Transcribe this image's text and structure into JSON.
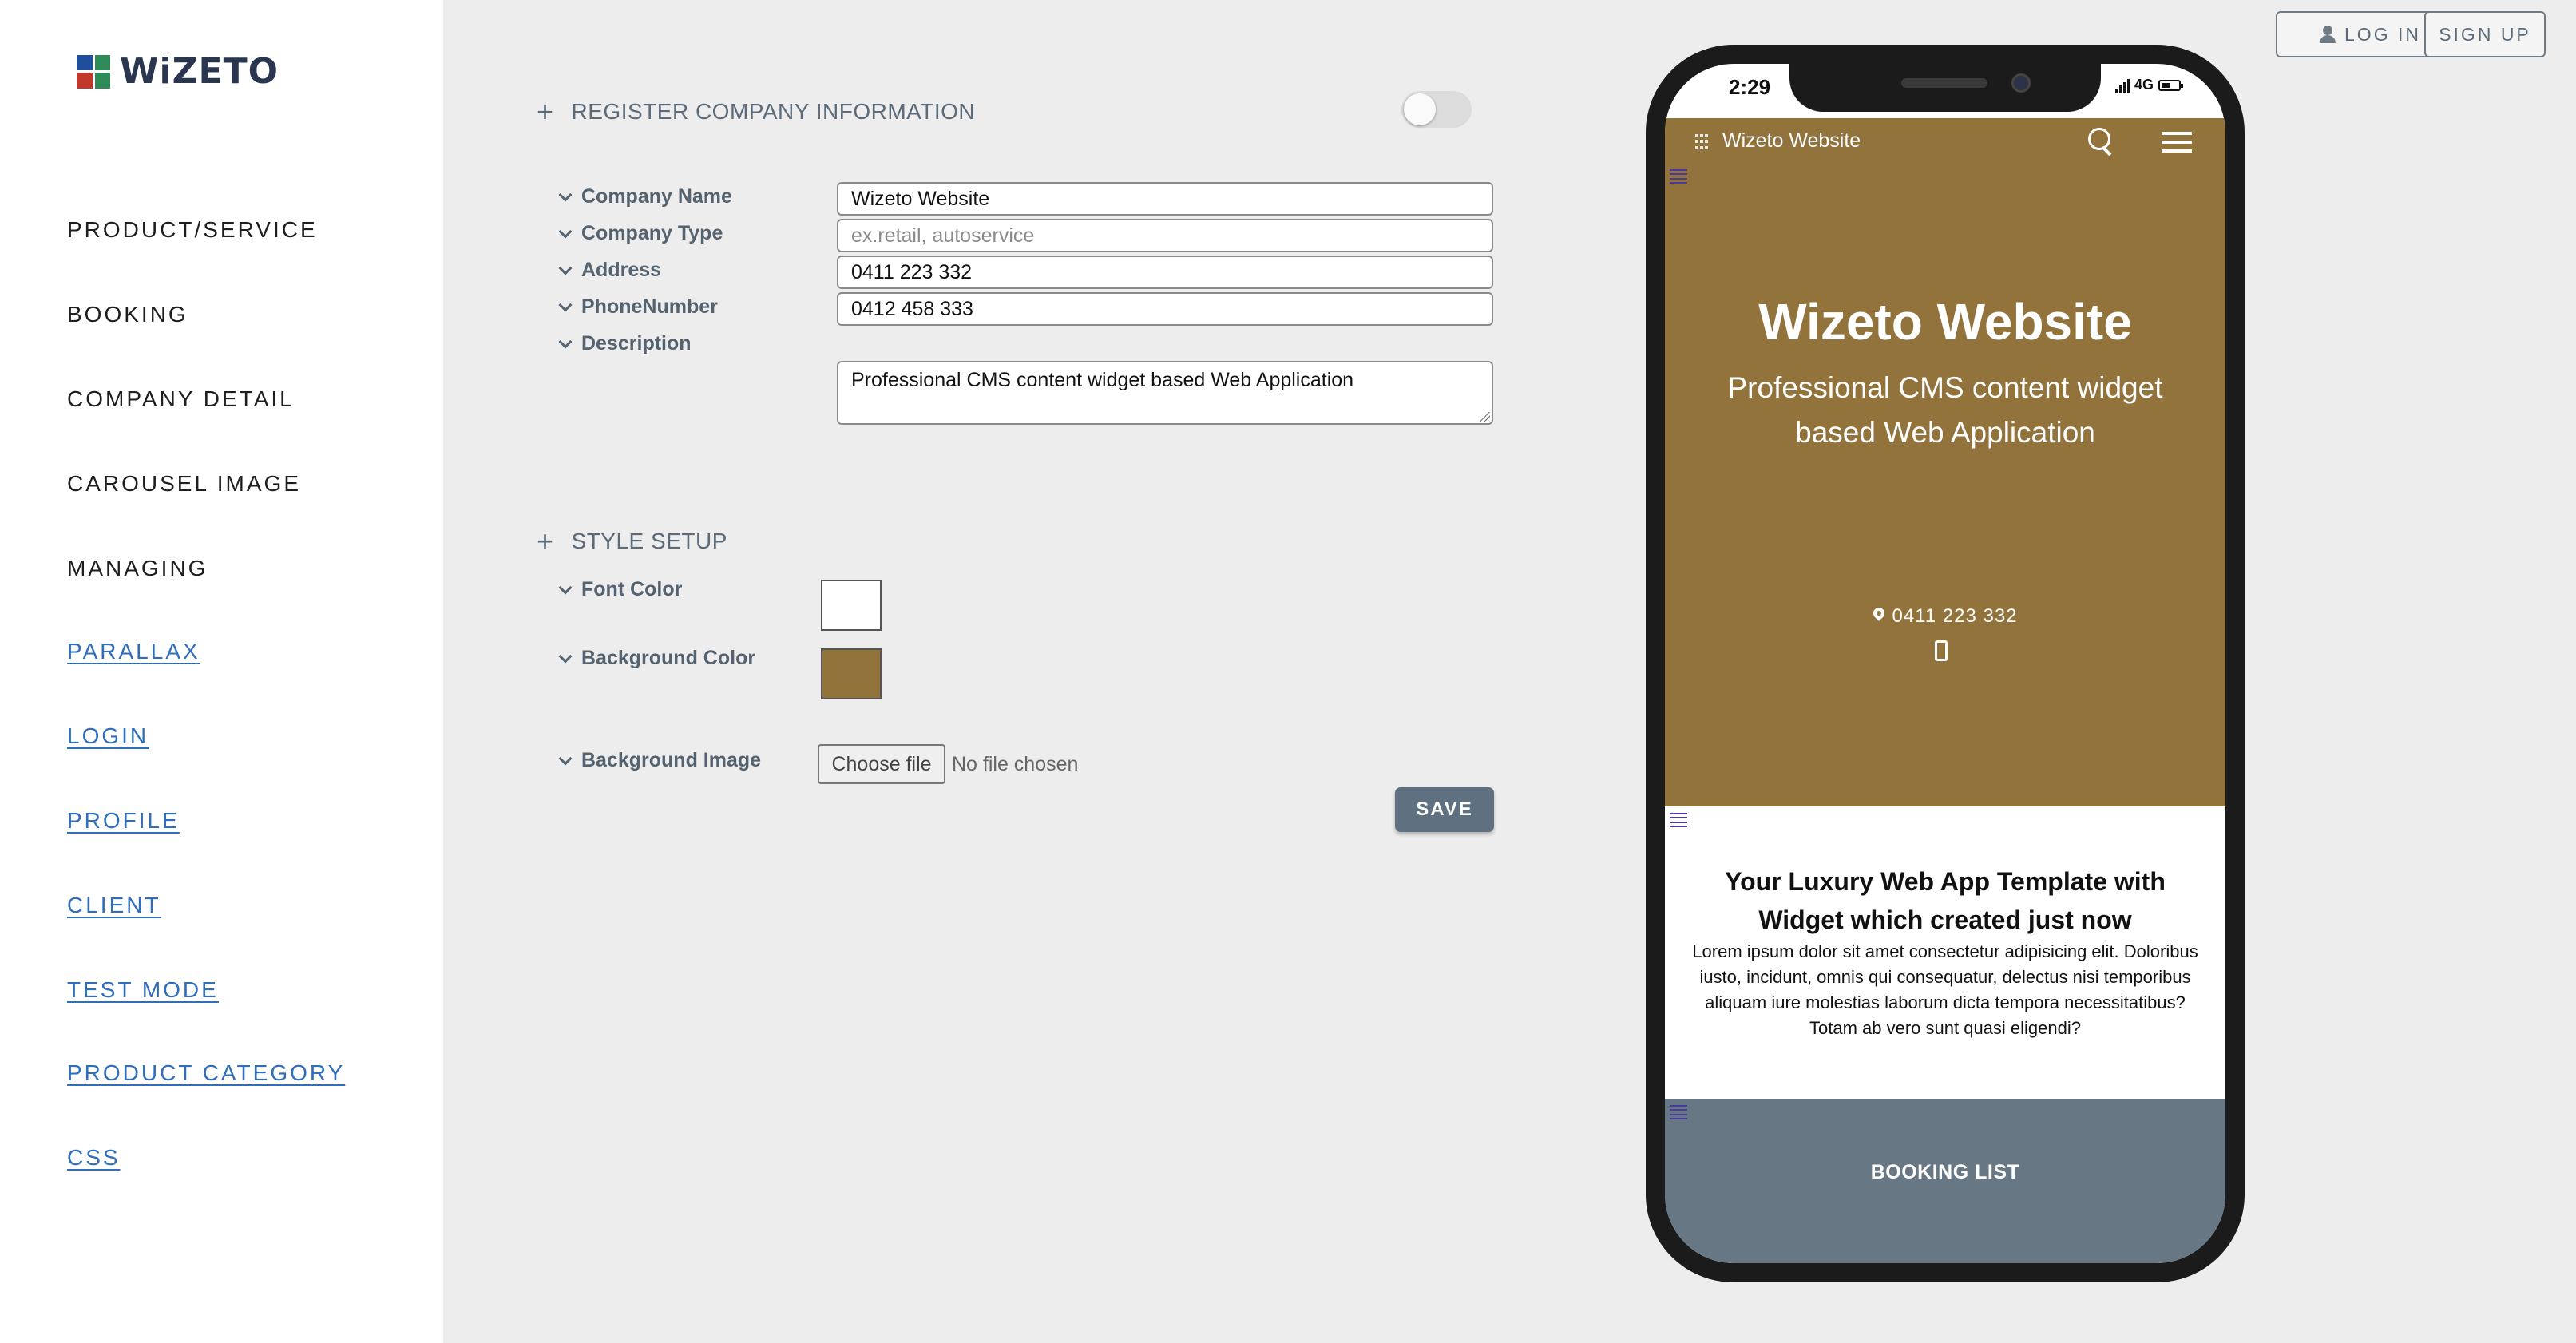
{
  "brand": {
    "name": "WiZETO",
    "colors": [
      "#1f4e9c",
      "#2e8b57",
      "#c0392b",
      "#2e8b57"
    ]
  },
  "sidebar": {
    "items": [
      {
        "label": "PRODUCT/SERVICE",
        "link": false
      },
      {
        "label": "BOOKING",
        "link": false
      },
      {
        "label": "COMPANY DETAIL",
        "link": false
      },
      {
        "label": "CAROUSEL IMAGE",
        "link": false
      },
      {
        "label": "MANAGING",
        "link": false
      },
      {
        "label": "PARALLAX",
        "link": true
      },
      {
        "label": "LOGIN",
        "link": true
      },
      {
        "label": "PROFILE",
        "link": true
      },
      {
        "label": "CLIENT",
        "link": true
      },
      {
        "label": "TEST MODE",
        "link": true
      },
      {
        "label": "PRODUCT CATEGORY",
        "link": true
      },
      {
        "label": "CSS",
        "link": true
      }
    ]
  },
  "header": {
    "login_label": "LOG IN",
    "signup_label": "SIGN UP"
  },
  "company_form": {
    "section_title": "REGISTER COMPANY INFORMATION",
    "toggle_on": false,
    "fields": {
      "company_name": {
        "label": "Company Name",
        "value": "Wizeto Website"
      },
      "company_type": {
        "label": "Company Type",
        "value": "",
        "placeholder": "ex.retail, autoservice"
      },
      "address": {
        "label": "Address",
        "value": "0411 223 332"
      },
      "phone": {
        "label": "PhoneNumber",
        "value": "0412 458 333"
      },
      "description": {
        "label": "Description",
        "value": "Professional CMS content widget based Web Application"
      }
    }
  },
  "style_setup": {
    "section_title": "STYLE SETUP",
    "font_color": {
      "label": "Font Color",
      "value": "#ffffff"
    },
    "background_color": {
      "label": "Background Color",
      "value": "#93733c"
    },
    "background_image": {
      "label": "Background Image",
      "button_label": "Choose file",
      "status": "No file chosen"
    },
    "save_label": "SAVE"
  },
  "preview": {
    "status_time": "2:29",
    "network": "4G",
    "app_title": "Wizeto Website",
    "hero_title": "Wizeto Website",
    "hero_subtitle": "Professional CMS content widget based Web Application",
    "hero_phone": "0411 223 332",
    "section_title": "Your Luxury Web App Template with Widget which created just now",
    "section_body": "Lorem ipsum dolor sit amet consectetur adipisicing elit. Doloribus iusto, incidunt, omnis qui consequatur, delectus nisi temporibus aliquam iure molestias laborum dicta tempora necessitatibus? Totam ab vero sunt quasi eligendi?",
    "booking_title": "BOOKING LIST"
  }
}
